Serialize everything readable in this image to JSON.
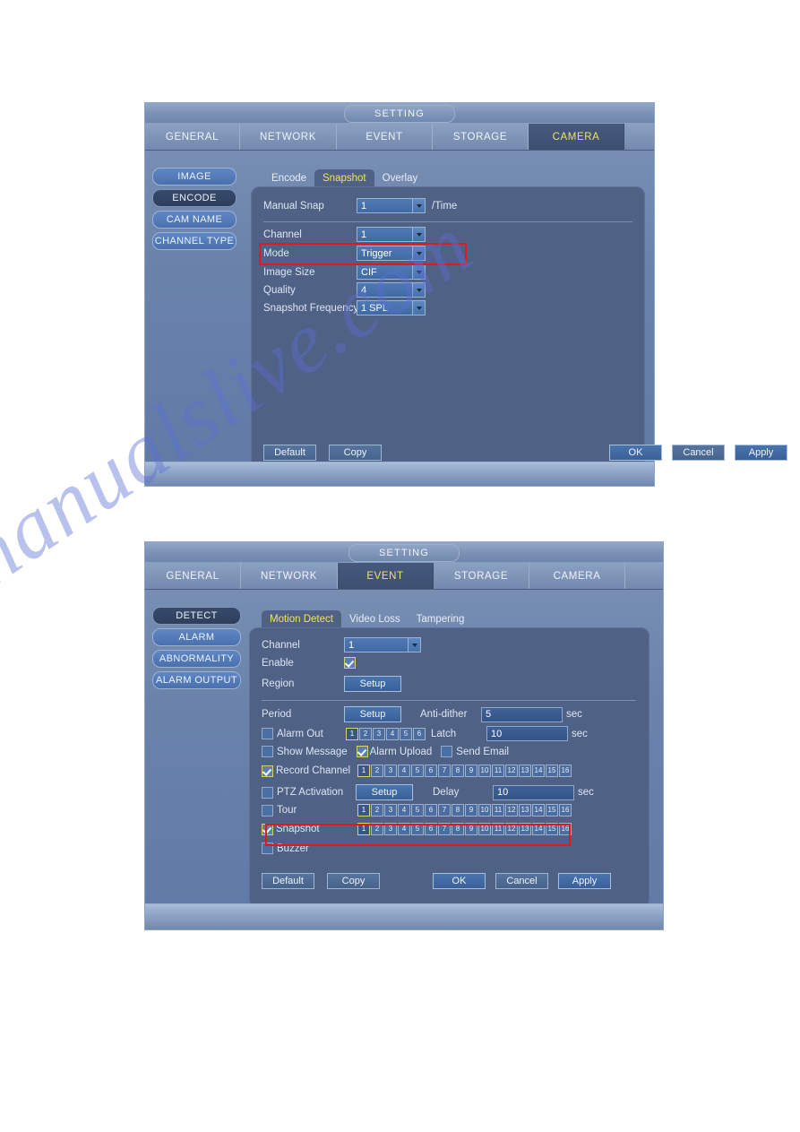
{
  "watermark": {
    "text": "manualslive.com"
  },
  "panel1": {
    "title": "SETTING",
    "tabs": [
      {
        "label": "GENERAL",
        "active": false
      },
      {
        "label": "NETWORK",
        "active": false
      },
      {
        "label": "EVENT",
        "active": false
      },
      {
        "label": "STORAGE",
        "active": false
      },
      {
        "label": "CAMERA",
        "active": true
      }
    ],
    "nav": [
      {
        "label": "IMAGE",
        "selected": true
      },
      {
        "label": "ENCODE",
        "selected": false
      },
      {
        "label": "CAM NAME",
        "selected": true
      },
      {
        "label": "CHANNEL TYPE",
        "selected": true
      }
    ],
    "subtabs": [
      {
        "label": "Encode",
        "active": false
      },
      {
        "label": "Snapshot",
        "active": true
      },
      {
        "label": "Overlay",
        "active": false
      }
    ],
    "fields": {
      "manual_snap_label": "Manual Snap",
      "manual_snap_value": "1",
      "manual_snap_suffix": "/Time",
      "channel_label": "Channel",
      "channel_value": "1",
      "mode_label": "Mode",
      "mode_value": "Trigger",
      "image_size_label": "Image Size",
      "image_size_value": "CIF",
      "quality_label": "Quality",
      "quality_value": "4",
      "snapshot_frequency_label": "Snapshot Frequency",
      "snapshot_frequency_value": "1 SPL"
    },
    "buttons": {
      "default": "Default",
      "copy": "Copy",
      "ok": "OK",
      "cancel": "Cancel",
      "apply": "Apply"
    }
  },
  "panel2": {
    "title": "SETTING",
    "tabs": [
      {
        "label": "GENERAL",
        "active": false
      },
      {
        "label": "NETWORK",
        "active": false
      },
      {
        "label": "EVENT",
        "active": true
      },
      {
        "label": "STORAGE",
        "active": false
      },
      {
        "label": "CAMERA",
        "active": false
      }
    ],
    "nav": [
      {
        "label": "DETECT",
        "selected": false
      },
      {
        "label": "ALARM",
        "selected": true
      },
      {
        "label": "ABNORMALITY",
        "selected": true
      },
      {
        "label": "ALARM OUTPUT",
        "selected": true
      }
    ],
    "subtabs": [
      {
        "label": "Motion Detect",
        "active": true
      },
      {
        "label": "Video Loss",
        "active": false
      },
      {
        "label": "Tampering",
        "active": false
      }
    ],
    "fields": {
      "channel_label": "Channel",
      "channel_value": "1",
      "enable_label": "Enable",
      "enable_checked": true,
      "region_label": "Region",
      "region_button": "Setup",
      "period_label": "Period",
      "period_button": "Setup",
      "antidither_label": "Anti-dither",
      "antidither_value": "5",
      "antidither_unit": "sec",
      "alarm_out_label": "Alarm Out",
      "alarm_out_checked": false,
      "latch_label": "Latch",
      "latch_value": "10",
      "latch_unit": "sec",
      "show_message_label": "Show Message",
      "show_message_checked": false,
      "alarm_upload_label": "Alarm Upload",
      "alarm_upload_checked": true,
      "send_email_label": "Send Email",
      "send_email_checked": false,
      "record_channel_label": "Record Channel",
      "record_channel_checked": true,
      "ptz_activation_label": "PTZ Activation",
      "ptz_activation_checked": false,
      "ptz_button": "Setup",
      "delay_label": "Delay",
      "delay_value": "10",
      "delay_unit": "sec",
      "tour_label": "Tour",
      "tour_checked": false,
      "snapshot_label": "Snapshot",
      "snapshot_checked": true,
      "buzzer_label": "Buzzer",
      "buzzer_checked": false
    },
    "alarm_out_channels": [
      "1",
      "2",
      "3",
      "4",
      "5",
      "6"
    ],
    "channels_16": [
      "1",
      "2",
      "3",
      "4",
      "5",
      "6",
      "7",
      "8",
      "9",
      "10",
      "11",
      "12",
      "13",
      "14",
      "15",
      "16"
    ],
    "selected_channel_index": 0,
    "buttons": {
      "default": "Default",
      "copy": "Copy",
      "ok": "OK",
      "cancel": "Cancel",
      "apply": "Apply"
    }
  },
  "colors": {
    "accent_yellow": "#f2e45a",
    "highlight_red": "#e01a1a",
    "panel_bg": "#4f6184",
    "window_bg": "#6b83ab"
  }
}
